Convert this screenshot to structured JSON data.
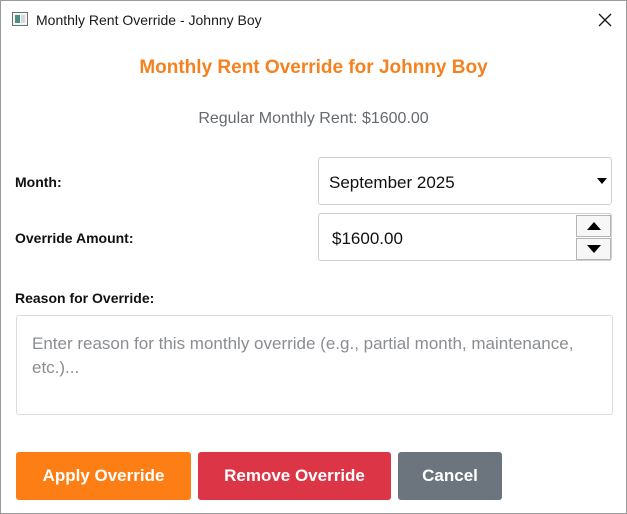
{
  "window": {
    "title": "Monthly Rent Override - Johnny Boy",
    "icon": "app-window-icon",
    "close_icon": "close-icon"
  },
  "header": {
    "title": "Monthly Rent Override for Johnny Boy",
    "regular_rent": "Regular Monthly Rent: $1600.00"
  },
  "form": {
    "month_label": "Month:",
    "month_value": "September 2025",
    "amount_label": "Override Amount:",
    "amount_value": "$1600.00",
    "reason_label": "Reason for Override:",
    "reason_value": "",
    "reason_placeholder": "Enter reason for this monthly override (e.g., partial month, maintenance, etc.)..."
  },
  "buttons": {
    "apply": "Apply Override",
    "remove": "Remove Override",
    "cancel": "Cancel"
  },
  "colors": {
    "accent": "#f58220",
    "apply": "#fd7e14",
    "remove": "#dc3545",
    "cancel": "#6c757d"
  }
}
